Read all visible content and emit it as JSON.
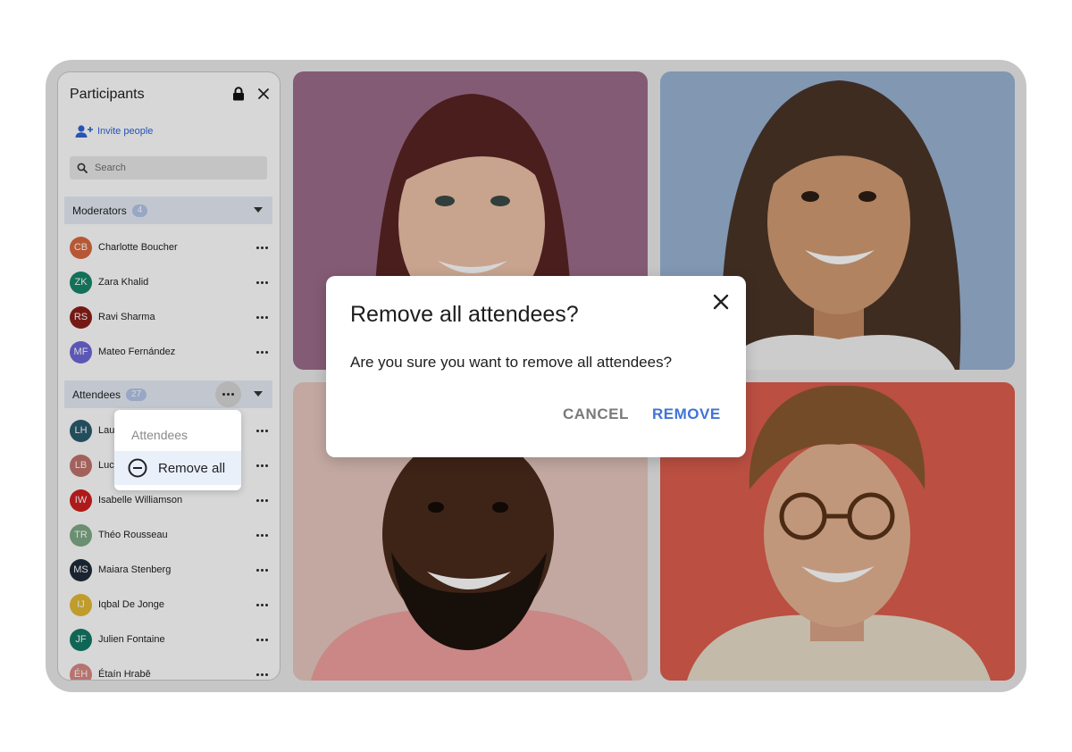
{
  "participants_panel": {
    "title": "Participants",
    "invite_label": "Invite people",
    "search_placeholder": "Search",
    "moderators": {
      "label": "Moderators",
      "count": "4",
      "items": [
        {
          "initials": "CB",
          "name": "Charlotte Boucher",
          "color": "#d9693f"
        },
        {
          "initials": "ZK",
          "name": "Zara Khalid",
          "color": "#17856a"
        },
        {
          "initials": "RS",
          "name": "Ravi Sharma",
          "color": "#8b1e18"
        },
        {
          "initials": "MF",
          "name": "Mateo Fernández",
          "color": "#6e68d8"
        }
      ]
    },
    "attendees": {
      "label": "Attendees",
      "count": "27",
      "items": [
        {
          "initials": "LH",
          "name": "Laura Hoffmann",
          "color": "#2a5c6e"
        },
        {
          "initials": "LB",
          "name": "Lucas Bernard",
          "color": "#c2736d"
        },
        {
          "initials": "IW",
          "name": "Isabelle Williamson",
          "color": "#d01e1e"
        },
        {
          "initials": "TR",
          "name": "Théo Rousseau",
          "color": "#7faa86"
        },
        {
          "initials": "MS",
          "name": "Maiara Stenberg",
          "color": "#1f2b3a"
        },
        {
          "initials": "IJ",
          "name": "Iqbal De Jonge",
          "color": "#e3ba35"
        },
        {
          "initials": "JF",
          "name": "Julien Fontaine",
          "color": "#137a64"
        },
        {
          "initials": "ÉH",
          "name": "Étaín Hrabě",
          "color": "#d98982"
        }
      ]
    }
  },
  "context_menu": {
    "header": "Attendees",
    "remove_all": "Remove all"
  },
  "dialog": {
    "title": "Remove all attendees?",
    "body": "Are you sure you want to remove all attendees?",
    "cancel": "CANCEL",
    "remove": "REMOVE"
  },
  "tiles": [
    {
      "bg": "#9d6c8a"
    },
    {
      "bg": "#9ab3d3"
    },
    {
      "bg": "#e6c8bf"
    },
    {
      "bg": "#dd5e4f"
    }
  ],
  "colors": {
    "accent": "#3f74d9",
    "link": "#2f63d6"
  }
}
